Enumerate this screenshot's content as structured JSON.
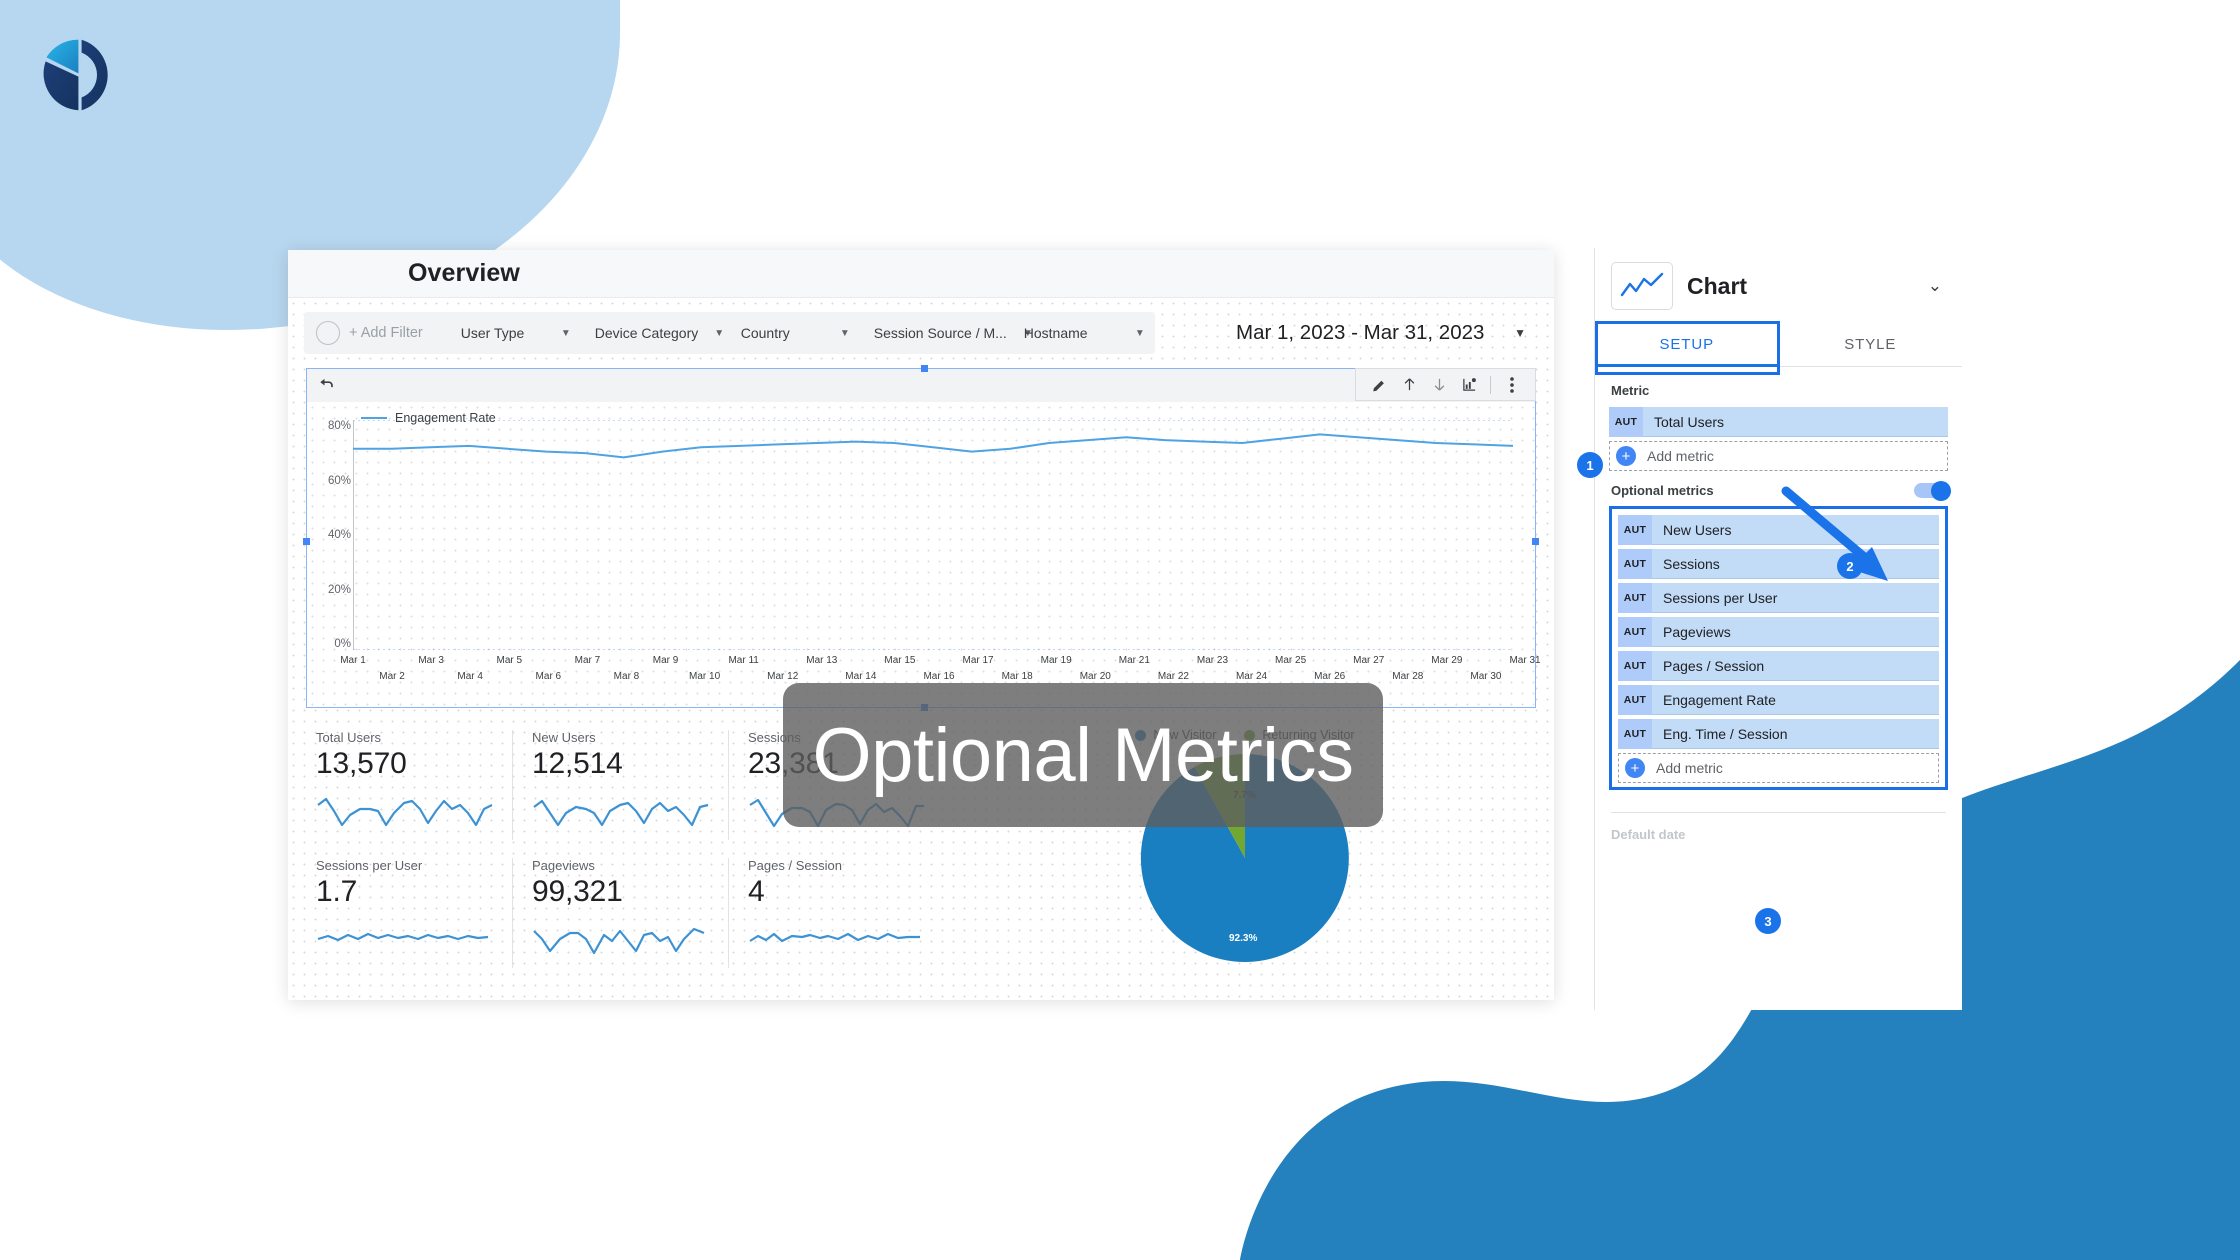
{
  "brand": {
    "logo_name": "pie-d-logo",
    "accent": "#1a73e8",
    "blob_blue": "#2481bd",
    "blob_light": "#b7d6ef"
  },
  "dashboard": {
    "title": "Overview",
    "filters": {
      "add_filter_label": "+ Add Filter",
      "dropdowns": [
        "User Type",
        "Device Category",
        "Country",
        "Session Source / M...",
        "Hostname"
      ],
      "date_range": "Mar 1, 2023 - Mar 31, 2023"
    },
    "toolbar_icons": [
      "pencil-icon",
      "arrow-up-icon",
      "arrow-down-icon",
      "chart-add-icon",
      "more-vertical-icon"
    ],
    "undo_icon": "undo-icon",
    "overlay_text": "Optional Metrics",
    "scorecards": [
      {
        "name": "Total Users",
        "value": "13,570"
      },
      {
        "name": "New Users",
        "value": "12,514"
      },
      {
        "name": "Sessions",
        "value": "23,381"
      },
      {
        "name": "Sessions per User",
        "value": "1.7"
      },
      {
        "name": "Pageviews",
        "value": "99,321"
      },
      {
        "name": "Pages / Session",
        "value": "4"
      }
    ]
  },
  "panel": {
    "title": "Chart",
    "thumb_icon": "line-chart-icon",
    "collapse_icon": "chevron-down-icon",
    "tabs": [
      {
        "label": "SETUP",
        "active": true
      },
      {
        "label": "STYLE",
        "active": false
      }
    ],
    "metric_label": "Metric",
    "metrics": [
      {
        "badge": "AUT",
        "name": "Total Users"
      }
    ],
    "add_metric_label": "Add metric",
    "optional_label": "Optional metrics",
    "optional_toggle_on": true,
    "optional_metrics": [
      {
        "badge": "AUT",
        "name": "New Users"
      },
      {
        "badge": "AUT",
        "name": "Sessions"
      },
      {
        "badge": "AUT",
        "name": "Sessions per User"
      },
      {
        "badge": "AUT",
        "name": "Pageviews"
      },
      {
        "badge": "AUT",
        "name": "Pages / Session"
      },
      {
        "badge": "AUT",
        "name": "Engagement Rate"
      },
      {
        "badge": "AUT",
        "name": "Eng. Time / Session"
      }
    ],
    "add_optional_metric_label": "Add metric",
    "footer_label": "Default date",
    "steps": [
      "1",
      "2",
      "3"
    ]
  },
  "chart_data": [
    {
      "type": "line",
      "title": "",
      "series": [
        {
          "name": "Engagement Rate",
          "values": [
            70,
            70,
            70.5,
            71,
            70,
            69,
            68.5,
            67,
            69,
            70.5,
            71,
            71.5,
            72,
            72.5,
            72,
            70.5,
            69,
            70,
            72,
            73,
            74,
            73,
            72.5,
            72,
            73.5,
            75,
            74,
            73,
            72,
            71.5,
            71
          ]
        }
      ],
      "categories": [
        "Mar 1",
        "Mar 2",
        "Mar 3",
        "Mar 4",
        "Mar 5",
        "Mar 6",
        "Mar 7",
        "Mar 8",
        "Mar 9",
        "Mar 10",
        "Mar 11",
        "Mar 12",
        "Mar 13",
        "Mar 14",
        "Mar 15",
        "Mar 16",
        "Mar 17",
        "Mar 18",
        "Mar 19",
        "Mar 20",
        "Mar 21",
        "Mar 22",
        "Mar 23",
        "Mar 24",
        "Mar 25",
        "Mar 26",
        "Mar 27",
        "Mar 28",
        "Mar 29",
        "Mar 30",
        "Mar 31"
      ],
      "yticks": [
        "0%",
        "20%",
        "40%",
        "60%",
        "80%"
      ],
      "ylim": [
        0,
        80
      ],
      "xlabel": "",
      "ylabel": "",
      "legend": [
        "Engagement Rate"
      ],
      "legend_position": "top-left",
      "grid": true,
      "line_color": "#4fa3e3"
    },
    {
      "type": "pie",
      "title": "",
      "labels": [
        "New Visitor",
        "Returning Visitor"
      ],
      "values": [
        92.3,
        7.7
      ],
      "value_labels": [
        "92.3%",
        "7.7%"
      ],
      "colors": [
        "#1a7fc1",
        "#72a832"
      ],
      "legend_position": "top"
    }
  ]
}
